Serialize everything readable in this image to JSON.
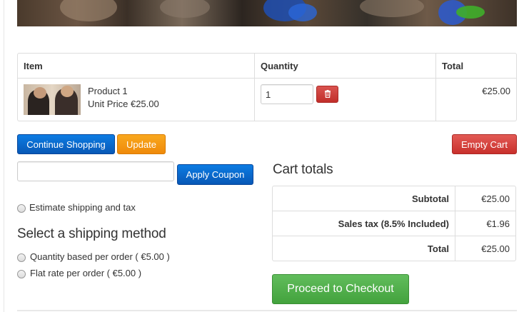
{
  "cart": {
    "headers": {
      "item": "Item",
      "quantity": "Quantity",
      "total": "Total"
    },
    "items": [
      {
        "name": "Product 1",
        "unit_price": "Unit Price €25.00",
        "quantity": "1",
        "total": "€25.00"
      }
    ]
  },
  "actions": {
    "continue_shopping": "Continue Shopping",
    "update": "Update",
    "empty_cart": "Empty Cart",
    "apply_coupon": "Apply Coupon",
    "proceed_checkout": "Proceed to Checkout"
  },
  "coupon": {
    "value": "",
    "placeholder": ""
  },
  "estimate": {
    "label": "Estimate shipping and tax"
  },
  "shipping": {
    "heading": "Select a shipping method",
    "options": [
      {
        "label": "Quantity based per order ( €5.00 )"
      },
      {
        "label": "Flat rate per order ( €5.00 )"
      }
    ]
  },
  "totals": {
    "heading": "Cart totals",
    "rows": [
      {
        "label": "Subtotal",
        "value": "€25.00"
      },
      {
        "label": "Sales tax (8.5% Included)",
        "value": "€1.96"
      },
      {
        "label": "Total",
        "value": "€25.00"
      }
    ]
  },
  "icons": {
    "delete": "trash-icon"
  },
  "colors": {
    "primary_blue": "#0a6bd3",
    "warning_orange": "#f4981a",
    "danger_red": "#d43f3a",
    "success_green": "#52b04c"
  }
}
